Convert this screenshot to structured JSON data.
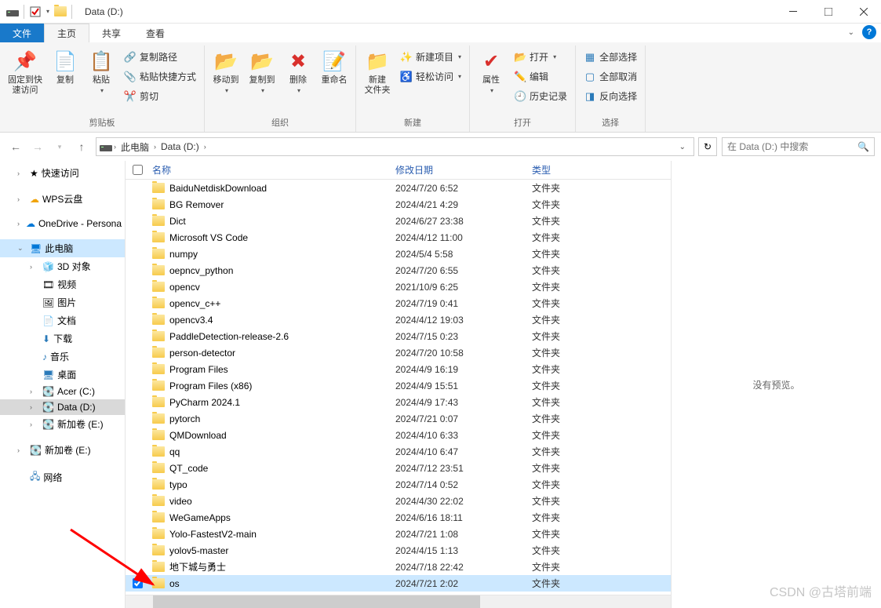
{
  "window": {
    "title": "Data (D:)"
  },
  "tabs": {
    "file": "文件",
    "home": "主页",
    "share": "共享",
    "view": "查看"
  },
  "ribbon": {
    "pin": "固定到快\n速访问",
    "copy": "复制",
    "paste": "粘贴",
    "copy_path": "复制路径",
    "paste_shortcut": "粘贴快捷方式",
    "cut": "剪切",
    "group_clipboard": "剪贴板",
    "move_to": "移动到",
    "copy_to": "复制到",
    "delete": "删除",
    "rename": "重命名",
    "group_organize": "组织",
    "new_folder": "新建\n文件夹",
    "new_item": "新建项目",
    "easy_access": "轻松访问",
    "group_new": "新建",
    "properties": "属性",
    "open": "打开",
    "edit": "编辑",
    "history": "历史记录",
    "group_open": "打开",
    "select_all": "全部选择",
    "select_none": "全部取消",
    "invert": "反向选择",
    "group_select": "选择"
  },
  "breadcrumb": {
    "pc": "此电脑",
    "drive": "Data (D:)"
  },
  "search": {
    "placeholder": "在 Data (D:) 中搜索"
  },
  "columns": {
    "name": "名称",
    "date": "修改日期",
    "type": "类型"
  },
  "nav": {
    "quick": "快速访问",
    "wps": "WPS云盘",
    "onedrive": "OneDrive - Persona",
    "pc": "此电脑",
    "3d": "3D 对象",
    "video": "视频",
    "pic": "图片",
    "doc": "文档",
    "dl": "下载",
    "music": "音乐",
    "desktop": "桌面",
    "acer": "Acer (C:)",
    "datad": "Data (D:)",
    "newe": "新加卷 (E:)",
    "newe2": "新加卷 (E:)",
    "network": "网络"
  },
  "files": [
    {
      "name": "BaiduNetdiskDownload",
      "date": "2024/7/20 6:52",
      "type": "文件夹"
    },
    {
      "name": "BG Remover",
      "date": "2024/4/21 4:29",
      "type": "文件夹"
    },
    {
      "name": "Dict",
      "date": "2024/6/27 23:38",
      "type": "文件夹"
    },
    {
      "name": "Microsoft VS Code",
      "date": "2024/4/12 11:00",
      "type": "文件夹"
    },
    {
      "name": "numpy",
      "date": "2024/5/4 5:58",
      "type": "文件夹"
    },
    {
      "name": "oepncv_python",
      "date": "2024/7/20 6:55",
      "type": "文件夹"
    },
    {
      "name": "opencv",
      "date": "2021/10/9 6:25",
      "type": "文件夹"
    },
    {
      "name": "opencv_c++",
      "date": "2024/7/19 0:41",
      "type": "文件夹"
    },
    {
      "name": "opencv3.4",
      "date": "2024/4/12 19:03",
      "type": "文件夹"
    },
    {
      "name": "PaddleDetection-release-2.6",
      "date": "2024/7/15 0:23",
      "type": "文件夹"
    },
    {
      "name": "person-detector",
      "date": "2024/7/20 10:58",
      "type": "文件夹"
    },
    {
      "name": "Program Files",
      "date": "2024/4/9 16:19",
      "type": "文件夹"
    },
    {
      "name": "Program Files (x86)",
      "date": "2024/4/9 15:51",
      "type": "文件夹"
    },
    {
      "name": "PyCharm 2024.1",
      "date": "2024/4/9 17:43",
      "type": "文件夹"
    },
    {
      "name": "pytorch",
      "date": "2024/7/21 0:07",
      "type": "文件夹"
    },
    {
      "name": "QMDownload",
      "date": "2024/4/10 6:33",
      "type": "文件夹"
    },
    {
      "name": "qq",
      "date": "2024/4/10 6:47",
      "type": "文件夹"
    },
    {
      "name": "QT_code",
      "date": "2024/7/12 23:51",
      "type": "文件夹"
    },
    {
      "name": "typo",
      "date": "2024/7/14 0:52",
      "type": "文件夹"
    },
    {
      "name": "video",
      "date": "2024/4/30 22:02",
      "type": "文件夹"
    },
    {
      "name": "WeGameApps",
      "date": "2024/6/16 18:11",
      "type": "文件夹"
    },
    {
      "name": "Yolo-FastestV2-main",
      "date": "2024/7/21 1:08",
      "type": "文件夹"
    },
    {
      "name": "yolov5-master",
      "date": "2024/4/15 1:13",
      "type": "文件夹"
    },
    {
      "name": "地下城与勇士",
      "date": "2024/7/18 22:42",
      "type": "文件夹"
    },
    {
      "name": "os",
      "date": "2024/7/21 2:02",
      "type": "文件夹",
      "selected": true
    }
  ],
  "preview": {
    "none": "没有预览。"
  },
  "watermark": "CSDN @古塔前端"
}
